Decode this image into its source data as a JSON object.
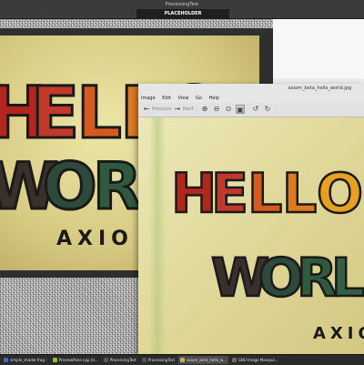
{
  "processing_window": {
    "title": "ProcessingTest",
    "placeholder_label": "PLACEHOLDER"
  },
  "preview_image": {
    "letters_line1": "HELLO",
    "letters_line2": "WORLD",
    "letters_line3": "AXIOM"
  },
  "viewer": {
    "title": "axiom_beta_hello_world.jpg",
    "menu": [
      "Image",
      "Edit",
      "View",
      "Go",
      "Help"
    ],
    "toolbar": {
      "previous_label": "Previous",
      "next_label": "Next",
      "zoom_in_icon": "zoom-in",
      "zoom_out_icon": "zoom-out",
      "zoom_fit_icon": "zoom-fit",
      "zoom_normal_icon": "zoom-normal",
      "rotate_left_icon": "rotate-left",
      "rotate_right_icon": "rotate-right"
    },
    "image_text": {
      "line1": "HELLO",
      "line2": "WORLD",
      "line3": "AXIO"
    }
  },
  "taskbar": {
    "items": [
      {
        "label": "simple_shader.frag -",
        "color": "#3b6db3"
      },
      {
        "label": "PreviewPane.cpp (d...",
        "color": "#8bbf4a"
      },
      {
        "label": "ProcessingTest",
        "color": "#3a3a3a"
      },
      {
        "label": "ProcessingTest",
        "color": "#3a3a3a"
      },
      {
        "label": "axiom_beta_hello_w...",
        "color": "#c9a86a"
      },
      {
        "label": "GNU Image Manipul...",
        "color": "#7a6a55"
      }
    ]
  },
  "colors": {
    "red": "#b3261e",
    "orange": "#e07a1e",
    "dark_green": "#2e4a3a",
    "yellow": "#efe6a6"
  }
}
